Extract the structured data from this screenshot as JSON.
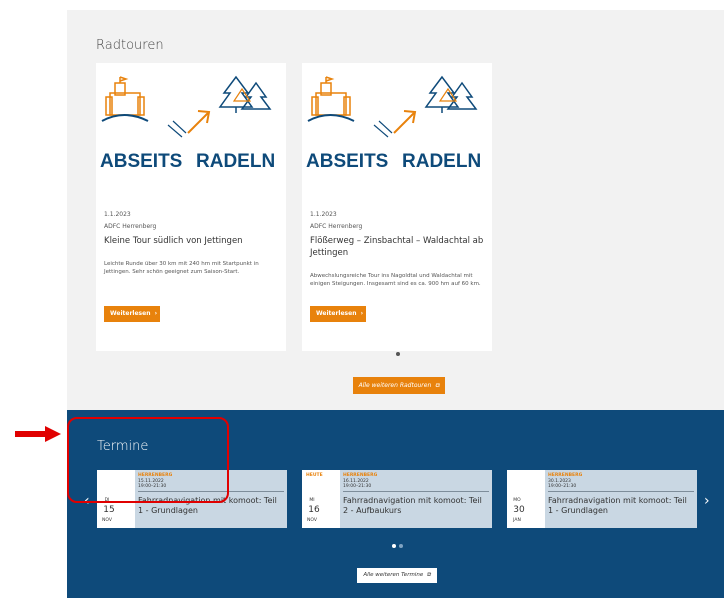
{
  "radtouren": {
    "heading": "Radtouren",
    "logo": {
      "word1": "ABSEITS",
      "word2": "RADELN"
    },
    "tours": [
      {
        "date": "1.1.2023",
        "org": "ADFC Herrenberg",
        "title": "Kleine Tour südlich von Jettingen",
        "desc": "Leichte Runde über 30 km mit 240 hm mit Startpunkt in Jettingen. Sehr schön geeignet zum Saison-Start.",
        "button": "Weiterlesen"
      },
      {
        "date": "1.1.2023",
        "org": "ADFC Herrenberg",
        "title": "Flößerweg – Zinsbachtal – Waldachtal ab Jettingen",
        "desc": "Abwechslungsreiche Tour ins Nagoldtal und Waldachtal mit einigen Steigungen. Insgesamt sind es ca. 900 hm auf 60 km.",
        "button": "Weiterlesen"
      }
    ],
    "all_button": "Alle weiteren Radtouren"
  },
  "termine": {
    "heading": "Termine",
    "events": [
      {
        "badge": "",
        "weekday": "DI",
        "day": "15",
        "month": "NOV",
        "category": "HERRENBERG",
        "date": "15.11.2022",
        "time": "19:00–21:30",
        "title": "Fahrradnavigation mit komoot: Teil 1 - Grundlagen"
      },
      {
        "badge": "HEUTE",
        "weekday": "MI",
        "day": "16",
        "month": "NOV",
        "category": "HERRENBERG",
        "date": "16.11.2022",
        "time": "19:00–21:30",
        "title": "Fahrradnavigation mit komoot: Teil 2 - Aufbaukurs"
      },
      {
        "badge": "",
        "weekday": "MO",
        "day": "30",
        "month": "JAN",
        "category": "HERRENBERG",
        "date": "30.1.2023",
        "time": "19:00–21:30",
        "title": "Fahrradnavigation mit komoot: Teil 1 - Grundlagen"
      }
    ],
    "all_button": "Alle weiteren Termine",
    "prev_label": "‹",
    "next_label": "›"
  },
  "colors": {
    "accent": "#e8820c",
    "navy": "#0e4a7a",
    "highlight": "#e00000"
  }
}
